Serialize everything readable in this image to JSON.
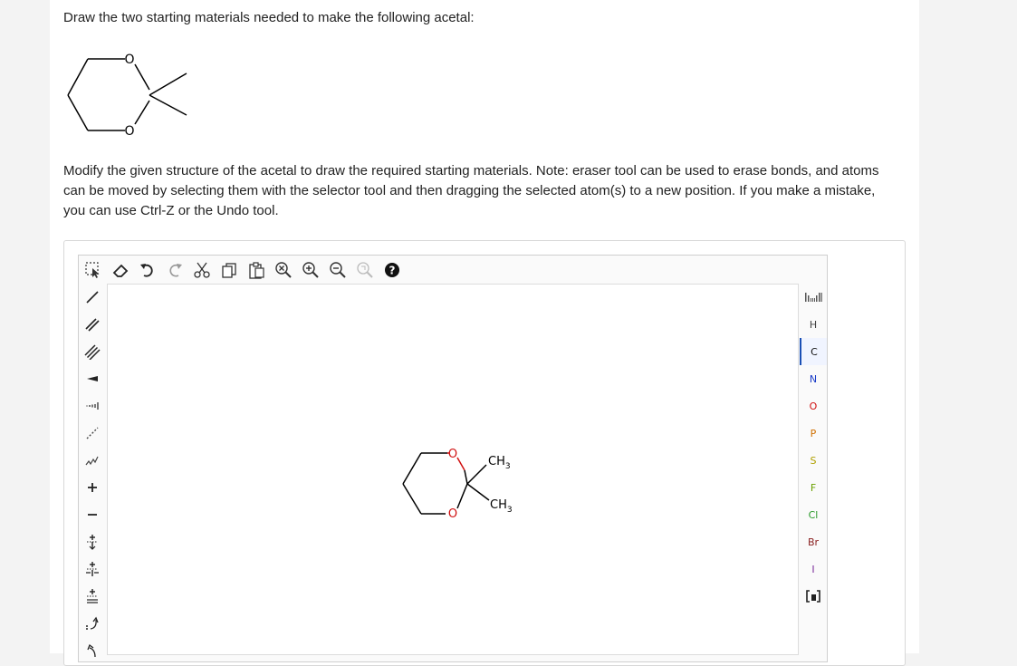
{
  "question": {
    "prompt": "Draw the two starting materials needed to make the following acetal:",
    "figure_atoms": {
      "o_top": "O",
      "o_bottom": "O"
    },
    "note": "Modify the given structure of the acetal to draw the required starting materials. Note: eraser tool can be used to erase bonds, and atoms can be moved by selecting them with the selector tool and then dragging the selected atom(s) to a new position. If you make a mistake, you can use Ctrl-Z or the Undo tool."
  },
  "editor": {
    "top_toolbar": [
      {
        "icon": "select-icon"
      },
      {
        "icon": "eraser-icon"
      },
      {
        "icon": "undo-icon"
      },
      {
        "icon": "redo-icon"
      },
      {
        "icon": "cut-icon"
      },
      {
        "icon": "copy-icon"
      },
      {
        "icon": "paste-icon"
      },
      {
        "icon": "zoom-reset-icon"
      },
      {
        "icon": "zoom-in-icon"
      },
      {
        "icon": "zoom-out-icon"
      },
      {
        "icon": "clean-icon"
      },
      {
        "icon": "help-icon"
      }
    ],
    "left_toolbar": [
      "single-bond",
      "double-bond",
      "triple-bond",
      "wedge-bond",
      "hash-bond",
      "dashed-bond",
      "wavy-bond",
      "positive-charge",
      "negative-charge",
      "lone-pair-plus",
      "radical-plus",
      "electrons-plus",
      "curved-arrow",
      "arrow"
    ],
    "molecule": {
      "o_top": "O",
      "o_bottom": "O",
      "methyl_1": {
        "main": "CH",
        "sub": "3"
      },
      "methyl_2": {
        "main": "CH",
        "sub": "3"
      }
    },
    "atoms": [
      {
        "symbol": "H",
        "color_class": "c-H"
      },
      {
        "symbol": "C",
        "color_class": "c-C",
        "selected": true
      },
      {
        "symbol": "N",
        "color_class": "c-N"
      },
      {
        "symbol": "O",
        "color_class": "c-O"
      },
      {
        "symbol": "P",
        "color_class": "c-P"
      },
      {
        "symbol": "S",
        "color_class": "c-S"
      },
      {
        "symbol": "F",
        "color_class": "c-F"
      },
      {
        "symbol": "Cl",
        "color_class": "c-Cl"
      },
      {
        "symbol": "Br",
        "color_class": "c-Br"
      },
      {
        "symbol": "I",
        "color_class": "c-I"
      }
    ]
  }
}
